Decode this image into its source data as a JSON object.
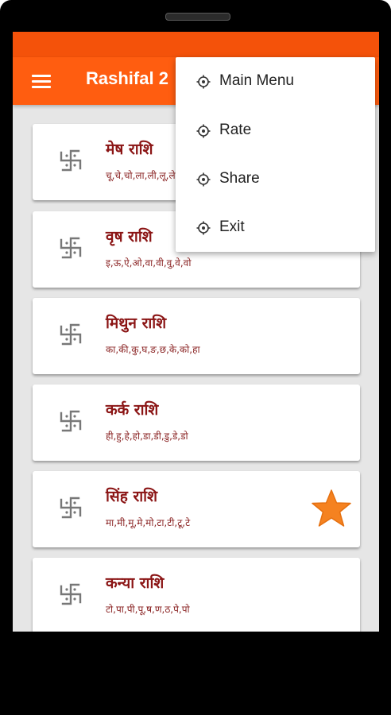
{
  "app": {
    "title": "Rashifal 2"
  },
  "menu": {
    "items": [
      {
        "label": "Main Menu",
        "icon": "gear-icon"
      },
      {
        "label": "Rate",
        "icon": "gear-icon"
      },
      {
        "label": "Share",
        "icon": "gear-icon"
      },
      {
        "label": "Exit",
        "icon": "gear-icon"
      }
    ]
  },
  "rashi_list": [
    {
      "title": "मेष राशि",
      "letters": "चू,चे,चो,ला,ली,लू,ले",
      "icon": "swastika-icon"
    },
    {
      "title": "वृष राशि",
      "letters": "इ,ऊ,ऐ,ओ,वा,वी,वु,वे,वो",
      "icon": "swastika-icon"
    },
    {
      "title": "मिथुन राशि",
      "letters": "का,की,कु,घ,ङ,छ,के,को,हा",
      "icon": "swastika-icon"
    },
    {
      "title": "कर्क राशि",
      "letters": "ही,हु,हे,हो,डा,डी,डु,डे,डो",
      "icon": "swastika-icon"
    },
    {
      "title": "सिंह राशि",
      "letters": "मा,मी,मू,मे,मो,टा,टी,टू,टे",
      "icon": "swastika-icon",
      "star": "star-icon"
    },
    {
      "title": "कन्या राशि",
      "letters": "टो,पा,पी,पू,ष,ण,ठ,पे,पो",
      "icon": "swastika-icon"
    }
  ],
  "colors": {
    "appbar": "#ff5d10",
    "statusbar": "#f4520a",
    "title_text": "#8b1515",
    "star": "#f58220"
  }
}
